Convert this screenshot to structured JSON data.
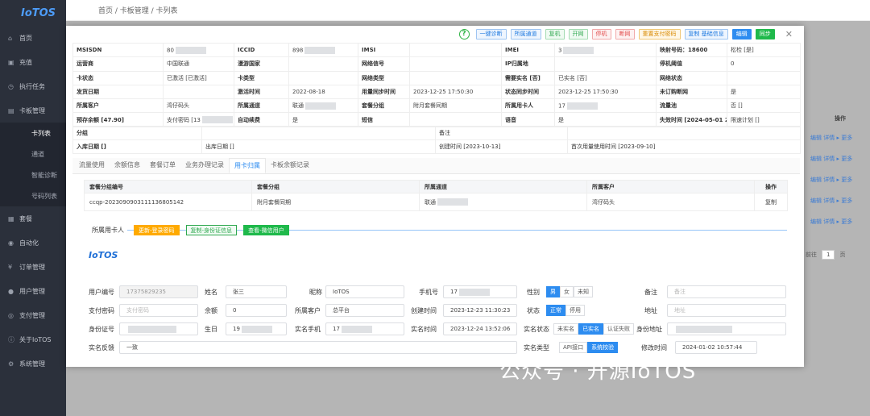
{
  "app": {
    "logo": "IoTOS"
  },
  "sidebar": {
    "items": [
      {
        "label": "首页"
      },
      {
        "label": "充值"
      },
      {
        "label": "执行任务"
      },
      {
        "label": "卡板管理"
      }
    ],
    "sub": [
      {
        "label": "卡列表"
      },
      {
        "label": "通道"
      },
      {
        "label": "智能诊断"
      },
      {
        "label": "号码列表"
      }
    ],
    "items2": [
      {
        "label": "套餐"
      },
      {
        "label": "自动化"
      },
      {
        "label": "订单管理"
      },
      {
        "label": "用户管理"
      },
      {
        "label": "支付管理"
      },
      {
        "label": "关于IoTOS"
      },
      {
        "label": "系统管理"
      }
    ]
  },
  "topbar": {
    "breadcrumb": "首页 / 卡板管理 / 卡列表"
  },
  "background": {
    "links": [
      "编辑  详情 ▸ 更多",
      "编辑  详情 ▸ 更多",
      "编辑  详情 ▸ 更多",
      "编辑  详情 ▸ 更多",
      "编辑  详情 ▸ 更多"
    ],
    "col": "操作",
    "page_prefix": "前往",
    "page_num": "1",
    "page_suffix": "页"
  },
  "toolbar": {
    "help": "?",
    "buttons": [
      "一键诊断",
      "所属通道",
      "复机",
      "开网",
      "停机",
      "断网",
      "重置支付密码",
      "复制 基础信息",
      "编辑",
      "同步"
    ],
    "close": "✕"
  },
  "info": [
    [
      "MSISDN",
      "80",
      "ICCID",
      "898",
      "IMSI",
      "",
      "IMEI",
      "3",
      "映射号码：18600",
      "松检 [是]"
    ],
    [
      "运营商",
      "中国联通",
      "漫游国家",
      "",
      "网络信号",
      "",
      "IP归属地",
      "",
      "停机阈值",
      "0"
    ],
    [
      "卡状态",
      "已激活 [已激活]",
      "卡类型",
      "",
      "网络类型",
      "",
      "需要实名 [否]",
      "已实名 [否]",
      "网络状态",
      ""
    ],
    [
      "发货日期",
      "",
      "激活时间",
      "2022-08-18",
      "用量同步时间",
      "2023-12-25 17:50:30",
      "状态同步时间",
      "2023-12-25 17:50:30",
      "未订购断网",
      "是"
    ],
    [
      "所属客户",
      "湾仔码头",
      "所属通道",
      "联通",
      "套餐分组",
      "附月套餐同期",
      "所属用卡人",
      "17",
      "流量池",
      "否 []"
    ],
    [
      "预存余额 [47.90]",
      "支付密码 [13",
      "自动续费",
      "是",
      "短信",
      "",
      "语音",
      "是",
      "失效时间 [2024-05-01 23:59:59]",
      "限速计划 []"
    ]
  ],
  "info2": [
    [
      "分组",
      "",
      "备注",
      ""
    ],
    [
      "入库日期 []",
      "出库日期 []",
      "创建时间 [2023-10-13]",
      "首次用量使用时间 [2023-09-10]"
    ]
  ],
  "tabs": [
    "流量使用",
    "余额信息",
    "套餐订单",
    "业务办理记录",
    "用卡归属",
    "卡板余额记录"
  ],
  "group_table": {
    "headers": [
      "套餐分组编号",
      "套餐分组",
      "所属通道",
      "所属客户",
      "操作"
    ],
    "rows": [
      [
        "ccqp-2023090903111136805142",
        "附月套餐同期",
        "联通",
        "湾仔码头",
        "复制"
      ]
    ]
  },
  "section": {
    "title": "所属用卡人",
    "btn1": "更新-登录密码",
    "btn2": "复制-身份证信息",
    "btn3": "查看-微信用户"
  },
  "form": {
    "user_no_l": "用户编号",
    "user_no": "17375829235",
    "name_l": "姓名",
    "name": "张三",
    "nick_l": "昵称",
    "nick": "IoTOS",
    "phone_l": "手机号",
    "phone": "17",
    "gender_l": "性别",
    "gender": [
      "男",
      "女",
      "未知"
    ],
    "remark_l": "备注",
    "remark_ph": "备注",
    "paypwd_l": "支付密码",
    "paypwd_ph": "支付密码",
    "balance_l": "余额",
    "balance": "0",
    "cust_l": "所属客户",
    "cust": "总平台",
    "created_l": "创建时间",
    "created": "2023-12-23 11:30:23",
    "status_l": "状态",
    "status": [
      "正常",
      "停用"
    ],
    "addr_l": "地址",
    "addr_ph": "地址",
    "idno_l": "身份证号",
    "birth_l": "生日",
    "birth": "19",
    "realphone_l": "实名手机",
    "realphone": "17",
    "realtime_l": "实名时间",
    "realtime": "2023-12-24 13:52:06",
    "realstate_l": "实名状态",
    "realstate": [
      "未实名",
      "已实名",
      "认证失败"
    ],
    "idaddr_l": "身份地址",
    "idaddr": "",
    "feedback_l": "实名反馈",
    "feedback": "一致",
    "realtype_l": "实名类型",
    "realtype": [
      "API接口",
      "系统校验"
    ],
    "modified_l": "修改时间",
    "modified": "2024-01-02 10:57:44"
  },
  "watermark": "公众号 · 开源IoTOS"
}
